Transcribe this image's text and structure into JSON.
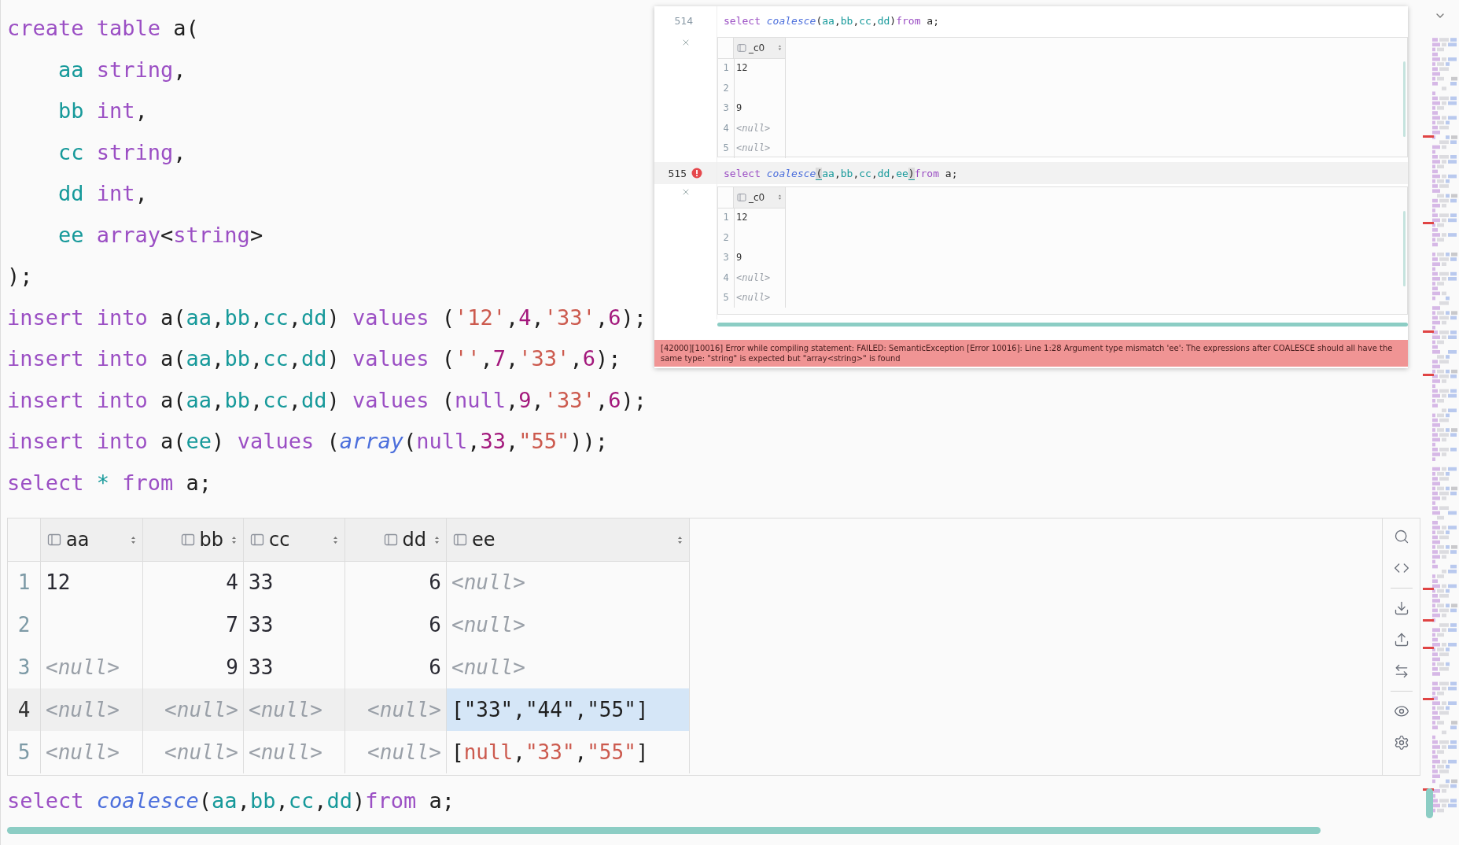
{
  "editor": {
    "lines": [
      {
        "tokens": [
          {
            "kind": "keyword",
            "text": "create "
          },
          {
            "kind": "keyword",
            "text": "table "
          },
          {
            "kind": "plain",
            "text": "a("
          }
        ]
      },
      {
        "tokens": [
          {
            "kind": "ident",
            "text": "    aa "
          },
          {
            "kind": "keyword",
            "text": "string"
          },
          {
            "kind": "plain",
            "text": ","
          }
        ]
      },
      {
        "tokens": [
          {
            "kind": "ident",
            "text": "    bb "
          },
          {
            "kind": "keyword",
            "text": "int"
          },
          {
            "kind": "plain",
            "text": ","
          }
        ]
      },
      {
        "tokens": [
          {
            "kind": "ident",
            "text": "    cc "
          },
          {
            "kind": "keyword",
            "text": "string"
          },
          {
            "kind": "plain",
            "text": ","
          }
        ]
      },
      {
        "tokens": [
          {
            "kind": "ident",
            "text": "    dd "
          },
          {
            "kind": "keyword",
            "text": "int"
          },
          {
            "kind": "plain",
            "text": ","
          }
        ]
      },
      {
        "tokens": [
          {
            "kind": "ident",
            "text": "    ee "
          },
          {
            "kind": "keyword",
            "text": "array"
          },
          {
            "kind": "plain",
            "text": "<"
          },
          {
            "kind": "keyword",
            "text": "string"
          },
          {
            "kind": "plain",
            "text": ">"
          }
        ]
      },
      {
        "tokens": [
          {
            "kind": "plain",
            "text": ");"
          }
        ]
      },
      {
        "tokens": [
          {
            "kind": "keyword",
            "text": "insert "
          },
          {
            "kind": "keyword",
            "text": "into "
          },
          {
            "kind": "plain",
            "text": "a("
          },
          {
            "kind": "ident",
            "text": "aa"
          },
          {
            "kind": "plain",
            "text": ","
          },
          {
            "kind": "ident",
            "text": "bb"
          },
          {
            "kind": "plain",
            "text": ","
          },
          {
            "kind": "ident",
            "text": "cc"
          },
          {
            "kind": "plain",
            "text": ","
          },
          {
            "kind": "ident",
            "text": "dd"
          },
          {
            "kind": "plain",
            "text": ") "
          },
          {
            "kind": "keyword",
            "text": "values "
          },
          {
            "kind": "plain",
            "text": "("
          },
          {
            "kind": "string",
            "text": "'12'"
          },
          {
            "kind": "plain",
            "text": ","
          },
          {
            "kind": "number",
            "text": "4"
          },
          {
            "kind": "plain",
            "text": ","
          },
          {
            "kind": "string",
            "text": "'33'"
          },
          {
            "kind": "plain",
            "text": ","
          },
          {
            "kind": "number",
            "text": "6"
          },
          {
            "kind": "plain",
            "text": ");"
          }
        ]
      },
      {
        "tokens": [
          {
            "kind": "keyword",
            "text": "insert "
          },
          {
            "kind": "keyword",
            "text": "into "
          },
          {
            "kind": "plain",
            "text": "a("
          },
          {
            "kind": "ident",
            "text": "aa"
          },
          {
            "kind": "plain",
            "text": ","
          },
          {
            "kind": "ident",
            "text": "bb"
          },
          {
            "kind": "plain",
            "text": ","
          },
          {
            "kind": "ident",
            "text": "cc"
          },
          {
            "kind": "plain",
            "text": ","
          },
          {
            "kind": "ident",
            "text": "dd"
          },
          {
            "kind": "plain",
            "text": ") "
          },
          {
            "kind": "keyword",
            "text": "values "
          },
          {
            "kind": "plain",
            "text": "("
          },
          {
            "kind": "string",
            "text": "''"
          },
          {
            "kind": "plain",
            "text": ","
          },
          {
            "kind": "number",
            "text": "7"
          },
          {
            "kind": "plain",
            "text": ","
          },
          {
            "kind": "string",
            "text": "'33'"
          },
          {
            "kind": "plain",
            "text": ","
          },
          {
            "kind": "number",
            "text": "6"
          },
          {
            "kind": "plain",
            "text": ");"
          }
        ]
      },
      {
        "tokens": [
          {
            "kind": "keyword",
            "text": "insert "
          },
          {
            "kind": "keyword",
            "text": "into "
          },
          {
            "kind": "plain",
            "text": "a("
          },
          {
            "kind": "ident",
            "text": "aa"
          },
          {
            "kind": "plain",
            "text": ","
          },
          {
            "kind": "ident",
            "text": "bb"
          },
          {
            "kind": "plain",
            "text": ","
          },
          {
            "kind": "ident",
            "text": "cc"
          },
          {
            "kind": "plain",
            "text": ","
          },
          {
            "kind": "ident",
            "text": "dd"
          },
          {
            "kind": "plain",
            "text": ") "
          },
          {
            "kind": "keyword",
            "text": "values "
          },
          {
            "kind": "plain",
            "text": "("
          },
          {
            "kind": "keyword",
            "text": "null"
          },
          {
            "kind": "plain",
            "text": ","
          },
          {
            "kind": "number",
            "text": "9"
          },
          {
            "kind": "plain",
            "text": ","
          },
          {
            "kind": "string",
            "text": "'33'"
          },
          {
            "kind": "plain",
            "text": ","
          },
          {
            "kind": "number",
            "text": "6"
          },
          {
            "kind": "plain",
            "text": ");"
          }
        ]
      },
      {
        "tokens": [
          {
            "kind": "keyword",
            "text": "insert "
          },
          {
            "kind": "keyword",
            "text": "into "
          },
          {
            "kind": "plain",
            "text": "a("
          },
          {
            "kind": "ident",
            "text": "ee"
          },
          {
            "kind": "plain",
            "text": ") "
          },
          {
            "kind": "keyword",
            "text": "values "
          },
          {
            "kind": "plain",
            "text": "("
          },
          {
            "kind": "func",
            "text": "array"
          },
          {
            "kind": "plain",
            "text": "("
          },
          {
            "kind": "keyword",
            "text": "null"
          },
          {
            "kind": "plain",
            "text": ","
          },
          {
            "kind": "number",
            "text": "33"
          },
          {
            "kind": "plain",
            "text": ","
          },
          {
            "kind": "string",
            "text": "\"55\""
          },
          {
            "kind": "plain",
            "text": "));"
          }
        ]
      },
      {
        "tokens": [
          {
            "kind": "keyword",
            "text": "select "
          },
          {
            "kind": "ident",
            "text": "* "
          },
          {
            "kind": "keyword",
            "text": "from "
          },
          {
            "kind": "plain",
            "text": "a;"
          }
        ]
      }
    ]
  },
  "result_grid": {
    "columns": [
      {
        "name": "aa",
        "numeric": false
      },
      {
        "name": "bb",
        "numeric": true
      },
      {
        "name": "cc",
        "numeric": false
      },
      {
        "name": "dd",
        "numeric": true
      },
      {
        "name": "ee",
        "numeric": false
      }
    ],
    "rows": [
      {
        "number": "1",
        "selected": false,
        "cells": [
          {
            "kind": "value",
            "text": "12",
            "focused": false
          },
          {
            "kind": "value",
            "text": "4",
            "focused": false
          },
          {
            "kind": "value",
            "text": "33",
            "focused": false
          },
          {
            "kind": "value",
            "text": "6",
            "focused": false
          },
          {
            "kind": "null",
            "text": "<null>",
            "focused": false
          }
        ]
      },
      {
        "number": "2",
        "selected": false,
        "cells": [
          {
            "kind": "empty",
            "focused": false
          },
          {
            "kind": "value",
            "text": "7",
            "focused": false
          },
          {
            "kind": "value",
            "text": "33",
            "focused": false
          },
          {
            "kind": "value",
            "text": "6",
            "focused": false
          },
          {
            "kind": "null",
            "text": "<null>",
            "focused": false
          }
        ]
      },
      {
        "number": "3",
        "selected": false,
        "cells": [
          {
            "kind": "null",
            "text": "<null>",
            "focused": false
          },
          {
            "kind": "value",
            "text": "9",
            "focused": false
          },
          {
            "kind": "value",
            "text": "33",
            "focused": false
          },
          {
            "kind": "value",
            "text": "6",
            "focused": false
          },
          {
            "kind": "null",
            "text": "<null>",
            "focused": false
          }
        ]
      },
      {
        "number": "4",
        "selected": true,
        "cells": [
          {
            "kind": "null",
            "text": "<null>",
            "focused": false
          },
          {
            "kind": "null",
            "text": "<null>",
            "focused": false
          },
          {
            "kind": "null",
            "text": "<null>",
            "focused": false
          },
          {
            "kind": "null",
            "text": "<null>",
            "focused": false
          },
          {
            "kind": "array",
            "tokens": [
              {
                "kind": "plain",
                "text": "[\"33\",\"44\",\"55\"]"
              }
            ],
            "focused": true
          }
        ]
      },
      {
        "number": "5",
        "selected": false,
        "cells": [
          {
            "kind": "null",
            "text": "<null>",
            "focused": false
          },
          {
            "kind": "null",
            "text": "<null>",
            "focused": false
          },
          {
            "kind": "null",
            "text": "<null>",
            "focused": false
          },
          {
            "kind": "null",
            "text": "<null>",
            "focused": false
          },
          {
            "kind": "array",
            "tokens": [
              {
                "kind": "plain",
                "text": "["
              },
              {
                "kind": "string",
                "text": "null"
              },
              {
                "kind": "plain",
                "text": ","
              },
              {
                "kind": "string",
                "text": "\"33\""
              },
              {
                "kind": "plain",
                "text": ","
              },
              {
                "kind": "string",
                "text": "\"55\""
              },
              {
                "kind": "plain",
                "text": "]"
              }
            ],
            "focused": false
          }
        ]
      }
    ]
  },
  "next_line": {
    "tokens": [
      {
        "kind": "keyword",
        "text": "select "
      },
      {
        "kind": "func",
        "text": "coalesce"
      },
      {
        "kind": "plain",
        "text": "("
      },
      {
        "kind": "ident",
        "text": "aa"
      },
      {
        "kind": "plain",
        "text": ","
      },
      {
        "kind": "ident",
        "text": "bb"
      },
      {
        "kind": "plain",
        "text": ","
      },
      {
        "kind": "ident",
        "text": "cc"
      },
      {
        "kind": "plain",
        "text": ","
      },
      {
        "kind": "ident",
        "text": "dd"
      },
      {
        "kind": "plain",
        "text": ")"
      },
      {
        "kind": "keyword",
        "text": "from"
      },
      {
        "kind": "plain",
        "text": " a;"
      }
    ]
  },
  "popup": {
    "entries": [
      {
        "line_number": "514",
        "error": false,
        "current": false,
        "tokens": [
          {
            "kind": "keyword",
            "text": "select "
          },
          {
            "kind": "func",
            "text": "coalesce"
          },
          {
            "kind": "plain",
            "text": "("
          },
          {
            "kind": "ident",
            "text": "aa"
          },
          {
            "kind": "plain",
            "text": ","
          },
          {
            "kind": "ident",
            "text": "bb"
          },
          {
            "kind": "plain",
            "text": ","
          },
          {
            "kind": "ident",
            "text": "cc"
          },
          {
            "kind": "plain",
            "text": ","
          },
          {
            "kind": "ident",
            "text": "dd"
          },
          {
            "kind": "plain",
            "text": ")"
          },
          {
            "kind": "keyword",
            "text": "from"
          },
          {
            "kind": "plain",
            "text": " a;"
          }
        ],
        "result": {
          "column": "_c0",
          "rows": [
            {
              "number": "1",
              "value": "12",
              "kind": "value"
            },
            {
              "number": "2",
              "kind": "empty"
            },
            {
              "number": "3",
              "value": "9",
              "kind": "value"
            },
            {
              "number": "4",
              "value": "<null>",
              "kind": "null"
            },
            {
              "number": "5",
              "value": "<null>",
              "kind": "null"
            }
          ]
        }
      },
      {
        "line_number": "515",
        "error": true,
        "current": true,
        "tokens": [
          {
            "kind": "keyword",
            "text": "select "
          },
          {
            "kind": "func",
            "text": "coalesce"
          },
          {
            "kind": "brace",
            "text": "("
          },
          {
            "kind": "ident",
            "text": "aa"
          },
          {
            "kind": "plain",
            "text": ","
          },
          {
            "kind": "ident",
            "text": "bb"
          },
          {
            "kind": "plain",
            "text": ","
          },
          {
            "kind": "ident",
            "text": "cc"
          },
          {
            "kind": "plain",
            "text": ","
          },
          {
            "kind": "ident",
            "text": "dd"
          },
          {
            "kind": "plain",
            "text": ","
          },
          {
            "kind": "ident",
            "text": "ee"
          },
          {
            "kind": "brace",
            "text": ")"
          },
          {
            "kind": "keyword",
            "text": "from"
          },
          {
            "kind": "plain",
            "text": " a;"
          }
        ],
        "result": {
          "column": "_c0",
          "rows": [
            {
              "number": "1",
              "value": "12",
              "kind": "value"
            },
            {
              "number": "2",
              "kind": "empty"
            },
            {
              "number": "3",
              "value": "9",
              "kind": "value"
            },
            {
              "number": "4",
              "value": "<null>",
              "kind": "null"
            },
            {
              "number": "5",
              "value": "<null>",
              "kind": "null"
            }
          ]
        }
      }
    ],
    "error_message": "[42000][10016] Error while compiling statement: FAILED: SemanticException [Error 10016]: Line 1:28 Argument type mismatch 'ee': The expressions after COALESCE should all have the same type: \"string\" is expected but \"array<string>\" is found"
  }
}
